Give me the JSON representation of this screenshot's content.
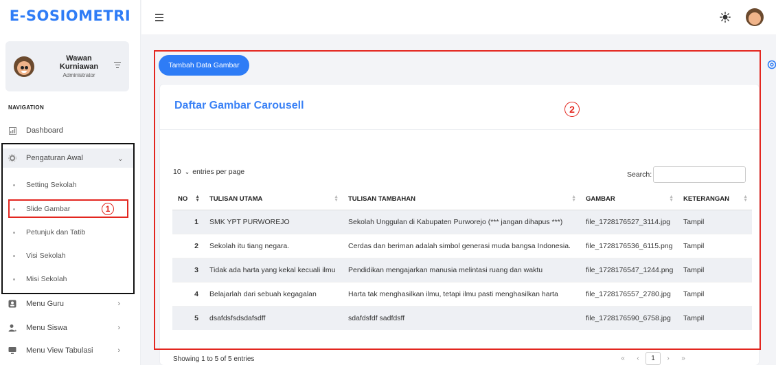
{
  "app": {
    "logo": "E-SOSIOMETRI"
  },
  "user": {
    "name": "Wawan Kurniawan",
    "role": "Administrator"
  },
  "nav": {
    "heading": "NAVIGATION",
    "dashboard": "Dashboard",
    "pengaturan": "Pengaturan Awal",
    "sub": [
      "Setting Sekolah",
      "Slide Gambar",
      "Petunjuk dan Tatib",
      "Visi Sekolah",
      "Misi Sekolah"
    ],
    "menu_guru": "Menu Guru",
    "menu_siswa": "Menu Siswa",
    "menu_tabulasi": "Menu View Tabulasi"
  },
  "annotations": {
    "one": "1",
    "two": "2"
  },
  "main": {
    "add_button": "Tambah Data Gambar",
    "card_title": "Daftar Gambar Carousell",
    "entries_value": "10",
    "entries_label": "entries per page",
    "search_label": "Search:",
    "columns": [
      "NO",
      "TULISAN UTAMA",
      "TULISAN TAMBAHAN",
      "GAMBAR",
      "KETERANGAN"
    ],
    "rows": [
      {
        "no": "1",
        "utama": "SMK YPT PURWOREJO",
        "tambahan": "Sekolah Unggulan di Kabupaten Purworejo (*** jangan dihapus ***)",
        "gambar": "file_1728176527_3114.jpg",
        "ket": "Tampil"
      },
      {
        "no": "2",
        "utama": "Sekolah itu tiang negara.",
        "tambahan": "Cerdas dan beriman adalah simbol generasi muda bangsa Indonesia.",
        "gambar": "file_1728176536_6115.png",
        "ket": "Tampil"
      },
      {
        "no": "3",
        "utama": "Tidak ada harta yang kekal kecuali ilmu",
        "tambahan": "Pendidikan mengajarkan manusia melintasi ruang dan waktu",
        "gambar": "file_1728176547_1244.png",
        "ket": "Tampil"
      },
      {
        "no": "4",
        "utama": "Belajarlah dari sebuah kegagalan",
        "tambahan": "Harta tak menghasilkan ilmu, tetapi ilmu pasti menghasilkan harta",
        "gambar": "file_1728176557_2780.jpg",
        "ket": "Tampil"
      },
      {
        "no": "5",
        "utama": "dsafdsfsdsdafsdff",
        "tambahan": "sdafdsfdf sadfdsff",
        "gambar": "file_1728176590_6758.jpg",
        "ket": "Tampil"
      }
    ],
    "footer": "Showing 1 to 5 of 5 entries",
    "pager": {
      "first": "«",
      "prev": "‹",
      "current": "1",
      "next": "›",
      "last": "»"
    }
  }
}
